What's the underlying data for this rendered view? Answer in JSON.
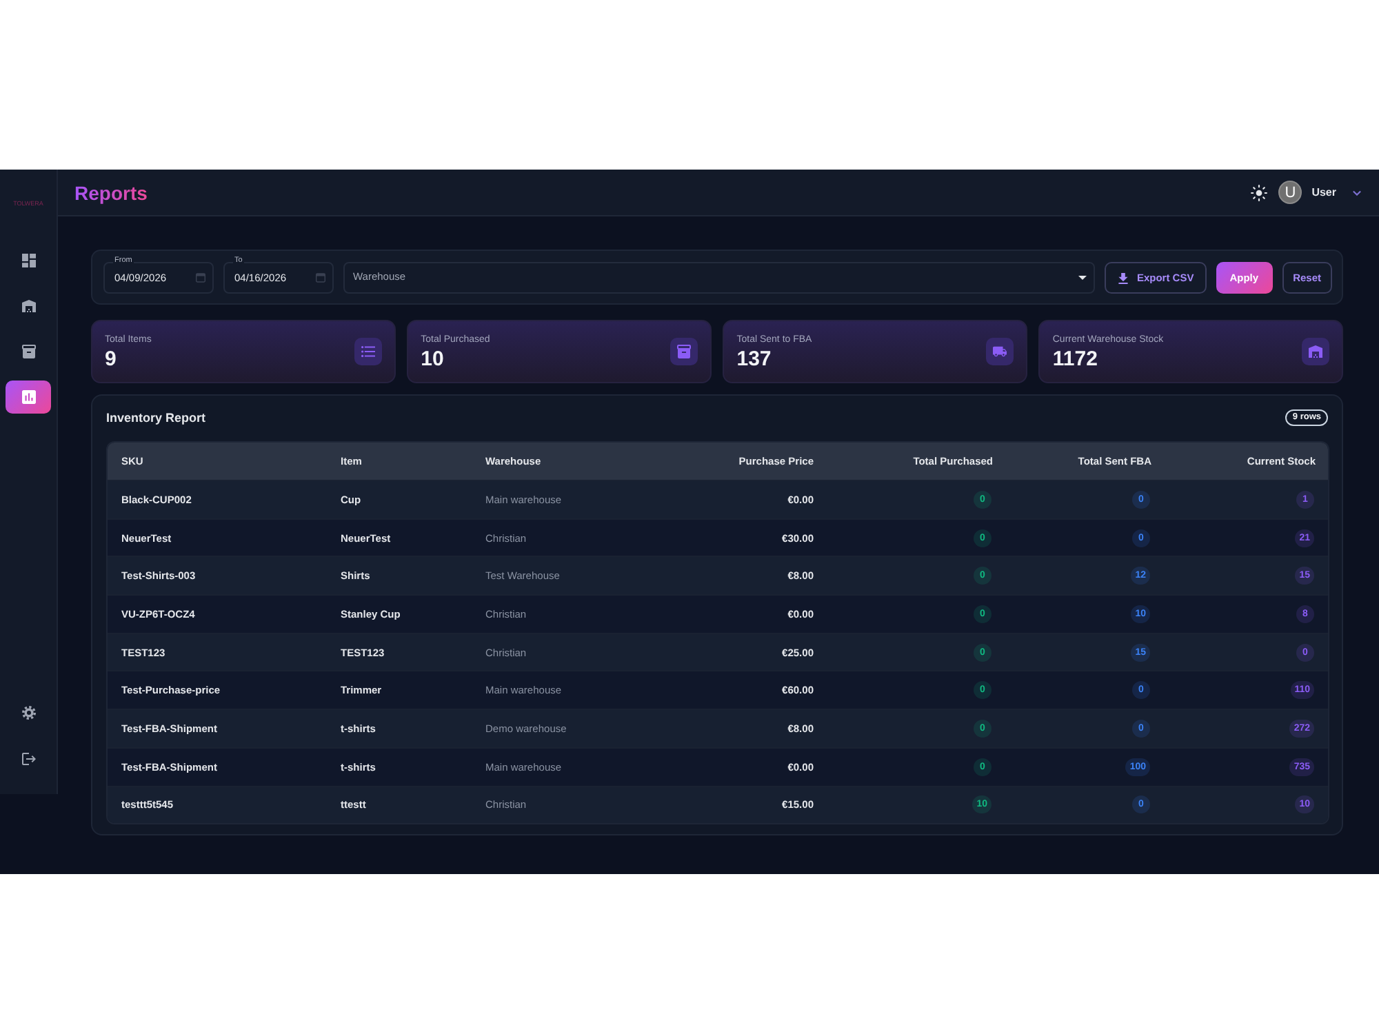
{
  "sidebar": {
    "logo": "TOLWERA",
    "items": [
      {
        "selected": false
      },
      {
        "selected": false
      },
      {
        "selected": false
      },
      {
        "selected": true
      }
    ]
  },
  "header": {
    "title": "Reports",
    "user": {
      "initial": "U",
      "name": "User"
    }
  },
  "filters": {
    "from": {
      "label": "From",
      "value": "04/09/2026"
    },
    "to": {
      "label": "To",
      "value": "04/16/2026"
    },
    "warehouse": {
      "label": "Warehouse"
    },
    "buttons": [
      {
        "label": "Export CSV",
        "kind": "export"
      },
      {
        "label": "Apply",
        "kind": "primary"
      },
      {
        "label": "Reset",
        "kind": "secondary"
      }
    ]
  },
  "stats": [
    {
      "label": "Total Items",
      "value": "9"
    },
    {
      "label": "Total Purchased",
      "value": "10"
    },
    {
      "label": "Total Sent to FBA",
      "value": "137"
    },
    {
      "label": "Current Warehouse Stock",
      "value": "1172"
    }
  ],
  "report": {
    "title": "Inventory Report",
    "row_count": "9 rows",
    "table": {
      "columns": [
        {
          "label": "SKU",
          "kind": "strong"
        },
        {
          "label": "Item",
          "kind": "strong"
        },
        {
          "label": "Warehouse",
          "kind": "muted"
        },
        {
          "label": "Purchase Price",
          "kind": "price"
        },
        {
          "label": "Total Purchased",
          "kind": "badge",
          "color": "#10b981"
        },
        {
          "label": "Total Sent FBA",
          "kind": "badge",
          "color": "#3b82f6"
        },
        {
          "label": "Current Stock",
          "kind": "badge",
          "color": "#8b5cf6"
        }
      ],
      "rows": [
        [
          "Black-CUP002",
          "Cup",
          "Main warehouse",
          "€0.00",
          "0",
          "0",
          "1"
        ],
        [
          "NeuerTest",
          "NeuerTest",
          "Christian",
          "€30.00",
          "0",
          "0",
          "21"
        ],
        [
          "Test-Shirts-003",
          "Shirts",
          "Test Warehouse",
          "€8.00",
          "0",
          "12",
          "15"
        ],
        [
          "VU-ZP6T-OCZ4",
          "Stanley Cup",
          "Christian",
          "€0.00",
          "0",
          "10",
          "8"
        ],
        [
          "TEST123",
          "TEST123",
          "Christian",
          "€25.00",
          "0",
          "15",
          "0"
        ],
        [
          "Test-Purchase-price",
          "Trimmer",
          "Main warehouse",
          "€60.00",
          "0",
          "0",
          "110"
        ],
        [
          "Test-FBA-Shipment",
          "t-shirts",
          "Demo warehouse",
          "€8.00",
          "0",
          "0",
          "272"
        ],
        [
          "Test-FBA-Shipment",
          "t-shirts",
          "Main warehouse",
          "€0.00",
          "0",
          "100",
          "735"
        ],
        [
          "testtt5t545",
          "ttestt",
          "Christian",
          "€15.00",
          "10",
          "0",
          "10"
        ]
      ]
    }
  }
}
